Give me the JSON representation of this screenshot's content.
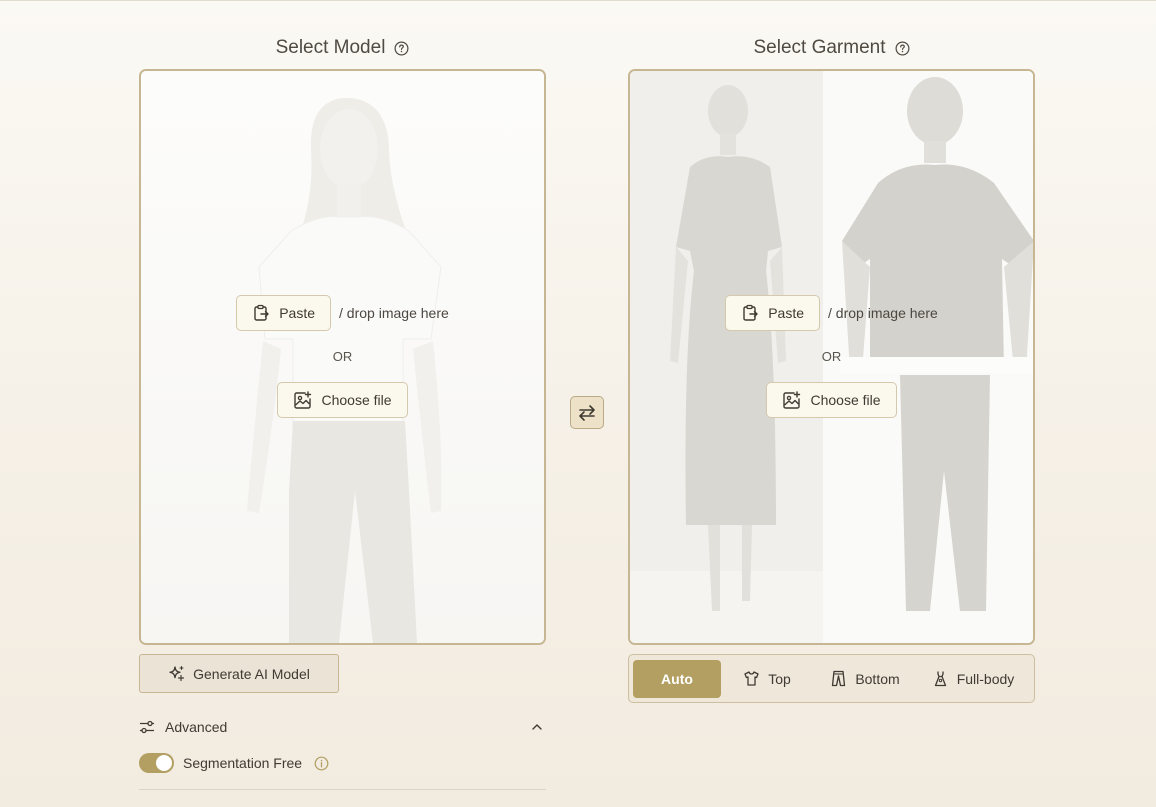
{
  "model_panel": {
    "title": "Select Model",
    "paste_label": "Paste",
    "drop_hint": "/ drop image here",
    "or_label": "OR",
    "choose_label": "Choose file"
  },
  "garment_panel": {
    "title": "Select Garment",
    "paste_label": "Paste",
    "drop_hint": "/ drop image here",
    "or_label": "OR",
    "choose_label": "Choose file"
  },
  "generate_button": {
    "label": "Generate AI Model"
  },
  "garment_types": {
    "selected": "Auto",
    "items": [
      {
        "label": "Auto",
        "icon": "none"
      },
      {
        "label": "Top",
        "icon": "tshirt-icon"
      },
      {
        "label": "Bottom",
        "icon": "pants-icon"
      },
      {
        "label": "Full-body",
        "icon": "dress-icon"
      }
    ]
  },
  "advanced": {
    "label": "Advanced",
    "expanded": true,
    "segmentation_free": {
      "label": "Segmentation Free",
      "enabled": true
    }
  },
  "colors": {
    "accent": "#b29f61",
    "panel_border": "#c7b692",
    "button_bg": "#ebe3d6"
  }
}
